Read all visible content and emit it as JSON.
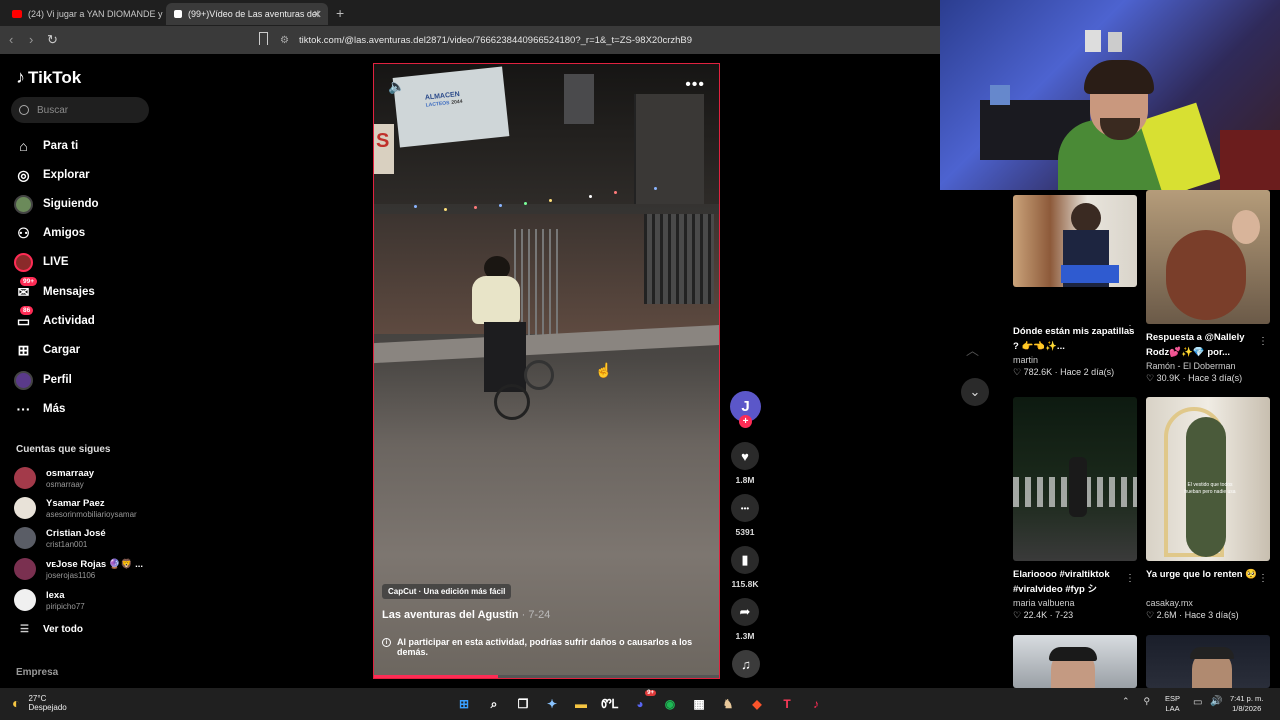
{
  "browser": {
    "tabs": [
      {
        "title": "(24) Vi jugar a YAN DIOMANDE y de",
        "active": false,
        "favicon_color": "#ff0000"
      },
      {
        "title": "(99+)Vídeo de Las aventuras del",
        "active": true,
        "favicon_color": "#ffffff"
      }
    ],
    "new_tab": "+",
    "back": "‹",
    "forward": "›",
    "reload": "↻",
    "url": "tiktok.com/@las.aventuras.del2871/video/7666238440966524180?_r=1&_t=ZS-98X20crzhB9"
  },
  "sidebar": {
    "logo": "TikTok",
    "search_placeholder": "Buscar",
    "nav": [
      {
        "label": "Para ti",
        "icon": "home-icon",
        "glyph": "⌂"
      },
      {
        "label": "Explorar",
        "icon": "compass-icon",
        "glyph": "◎"
      },
      {
        "label": "Siguiendo",
        "icon": "following-avatar",
        "glyph": ""
      },
      {
        "label": "Amigos",
        "icon": "friends-icon",
        "glyph": "⚇"
      },
      {
        "label": "LIVE",
        "icon": "live-avatar",
        "glyph": ""
      },
      {
        "label": "Mensajes",
        "icon": "messages-icon",
        "glyph": "✉",
        "badge": "99+"
      },
      {
        "label": "Actividad",
        "icon": "activity-icon",
        "glyph": "▭",
        "badge": "86"
      },
      {
        "label": "Cargar",
        "icon": "upload-icon",
        "glyph": "⊞"
      },
      {
        "label": "Perfil",
        "icon": "profile-avatar",
        "glyph": ""
      },
      {
        "label": "Más",
        "icon": "more-icon",
        "glyph": "···"
      }
    ],
    "following_heading": "Cuentas que sigues",
    "accounts": [
      {
        "name": "osmarraay",
        "username": "osmarraay",
        "color": "#a33a4a"
      },
      {
        "name": "Ysamar Paez",
        "username": "asesorinmobiliarioysamar",
        "color": "#e8e2d8"
      },
      {
        "name": "Cristian José",
        "username": "crist1an001",
        "color": "#5a5d66"
      },
      {
        "name": "Jose Rojas",
        "prefix": "ᴠᴇ",
        "suffix": "🔮🦁 ...",
        "username": "joserojas1106",
        "color": "#7a3050"
      },
      {
        "name": "lexa",
        "username": "piripicho77",
        "color": "#f0f0f0"
      }
    ],
    "see_all": "Ver todo",
    "company": "Empresa"
  },
  "video": {
    "capcut": "CapCut · Una edición más fácil",
    "author": "Las aventuras del Agustín",
    "date": "· 7-24",
    "warning": "Al participar en esta actividad, podrías sufrir daños o causarlos a los demás.",
    "progress": 0.36,
    "sign_text": "ALMACEN",
    "sign_sub": "LACTEOS",
    "sign_num": "2044",
    "sign_left": "S",
    "mute_icon": "🔈",
    "more_icon": "•••"
  },
  "actions": {
    "creator_initial": "J",
    "follow_plus": "+",
    "likes": "1.8M",
    "comments": "5391",
    "saves": "115.8K",
    "shares": "1.3M",
    "like_icon": "♥",
    "comment_icon": "•••",
    "save_icon": "▮",
    "share_icon": "➦",
    "music_icon": "♫"
  },
  "nav_arrows": {
    "up": "︿",
    "down": "⌄"
  },
  "recommendations": [
    {
      "title": "Dónde están mis zapatillas ? 👉👈✨...",
      "author": "martin",
      "likes": "♡ 782.6K",
      "date": "· Hace 2 día(s)",
      "more": "⋮"
    },
    {
      "title": "Respuesta a @Nallely Rodz💕✨💎 por...",
      "author": "Ramón - El Doberman",
      "likes": "♡ 30.9K",
      "date": "· Hace 3 día(s)",
      "more": "⋮"
    },
    {
      "title": "Elarioooo #viraltiktok #viralvideo #fyp シ",
      "author": "maria valbuena",
      "likes": "♡ 22.4K",
      "date": "· 7-23",
      "more": "⋮"
    },
    {
      "title": "Ya urge que lo renten 🥺",
      "author": "casakay.mx",
      "likes": "♡ 2.6M",
      "date": "· Hace 3 día(s)",
      "more": "⋮"
    }
  ],
  "rec_thumb_text": "El vestido que todos hueban pero nadie usa",
  "taskbar": {
    "temp": "27°C",
    "condition": "Despejado",
    "lang": "ESP",
    "lang2": "LAA",
    "time": "7:41 p. m.",
    "date": "1/8/2026",
    "chevron": "⌃",
    "icons": [
      {
        "name": "windows-start-icon",
        "glyph": "⊞",
        "color": "#3aa0ff"
      },
      {
        "name": "search-taskbar-icon",
        "glyph": "⌕",
        "color": "#ffffff"
      },
      {
        "name": "task-view-icon",
        "glyph": "❐",
        "color": "#ffffff"
      },
      {
        "name": "copilot-icon",
        "glyph": "✦",
        "color": "#8ac4ff"
      },
      {
        "name": "file-explorer-icon",
        "glyph": "▬",
        "color": "#f5c542"
      },
      {
        "name": "app-icon",
        "glyph": "ᏛᏞ",
        "color": "#ffffff"
      },
      {
        "name": "discord-icon",
        "glyph": "◕",
        "color": "#5865f2",
        "badge": "9+"
      },
      {
        "name": "spotify-icon",
        "glyph": "◉",
        "color": "#1db954"
      },
      {
        "name": "store-icon",
        "glyph": "▦",
        "color": "#ffffff"
      },
      {
        "name": "app-icon-2",
        "glyph": "♞",
        "color": "#e8c89a"
      },
      {
        "name": "brave-icon",
        "glyph": "◆",
        "color": "#fb542b"
      },
      {
        "name": "app-icon-3",
        "glyph": "T",
        "color": "#ff3a5a"
      },
      {
        "name": "tiktok-icon",
        "glyph": "♪",
        "color": "#ff2c55"
      }
    ]
  }
}
